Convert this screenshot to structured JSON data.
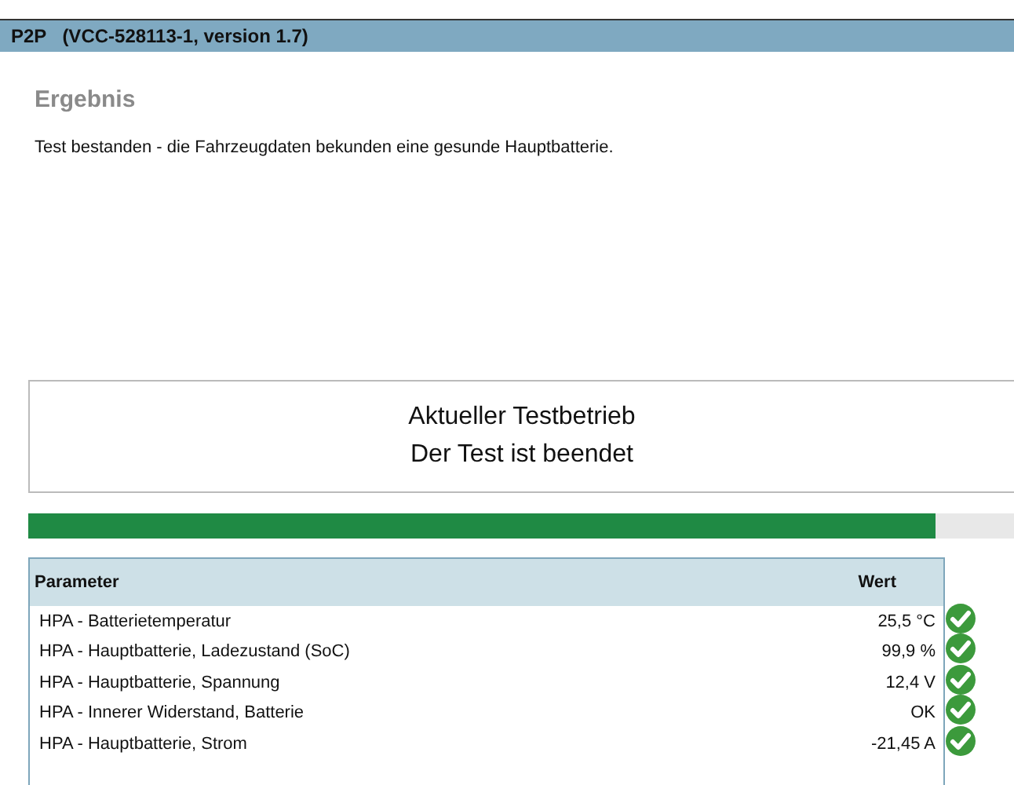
{
  "header": {
    "title": "P2P",
    "subtitle": "(VCC-528113-1, version 1.7)"
  },
  "result": {
    "heading": "Ergebnis",
    "message": "Test bestanden - die Fahrzeugdaten bekunden eine gesunde Hauptbatterie."
  },
  "status": {
    "title": "Aktueller Testbetrieb",
    "message": "Der Test ist beendet"
  },
  "progress": {
    "level": 0.92
  },
  "table": {
    "columns": [
      "Parameter",
      "Wert"
    ],
    "rows": [
      {
        "parameter": "HPA - Batterietemperatur",
        "value": "25,5 °C",
        "passed": true
      },
      {
        "parameter": "HPA - Hauptbatterie, Ladezustand (SoC)",
        "value": "99,9 %",
        "passed": true
      },
      {
        "parameter": "HPA - Hauptbatterie, Spannung",
        "value": "12,4 V",
        "passed": true
      },
      {
        "parameter": "HPA - Innerer Widerstand, Batterie",
        "value": "OK",
        "passed": true
      },
      {
        "parameter": "HPA - Hauptbatterie, Strom",
        "value": "-21,45 A",
        "passed": true
      }
    ]
  }
}
